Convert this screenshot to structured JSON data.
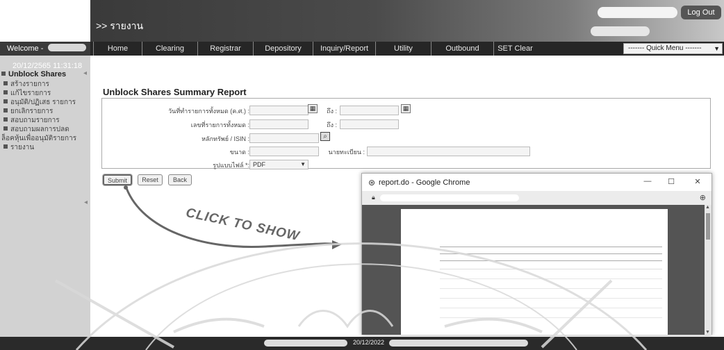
{
  "header": {
    "page_title": ">> รายงาน",
    "logout_label": "Log Out"
  },
  "welcome": {
    "label": "Welcome -"
  },
  "menu": {
    "items": [
      "Home",
      "Clearing",
      "Registrar",
      "Depository",
      "Inquiry/Report",
      "Utility",
      "Outbound",
      "SET Clear"
    ],
    "quick_menu": "------- Quick Menu -------"
  },
  "sidebar": {
    "datetime": "20/12/2565 11:31:18",
    "heading": "Unblock Shares",
    "items": [
      "สร้างรายการ",
      "แก้ไขรายการ",
      "อนุมัติ/ปฏิเสธ รายการ",
      "ยกเลิกรายการ",
      "สอบถามรายการ",
      "สอบถามผลการปลด",
      "ล็อคหุ้นเพื่ออนุมัติรายการ",
      "รายงาน"
    ]
  },
  "form": {
    "title": "Unblock Shares Summary Report",
    "date_label": "วันที่ทำรายการทั้งหมด (ค.ศ.) :",
    "date_to_label": "ถึง :",
    "number_label": "เลขที่รายการทั้งหมด :",
    "number_to_label": "ถึง :",
    "security_label": "หลักทรัพย์ / ISIN :",
    "size_label": "ขนาด :",
    "registrar_label": "นายทะเบียน :",
    "format_label": "รูปแบบไฟล์ *:",
    "format_value": "PDF"
  },
  "buttons": {
    "submit": "Submit",
    "reset": "Reset",
    "back": "Back"
  },
  "annotation": {
    "text": "CLICK TO SHOW"
  },
  "chrome": {
    "title": "report.do - Google Chrome",
    "minimize": "—",
    "maximize": "☐",
    "close": "✕"
  },
  "footer": {
    "date": "20/12/2022"
  },
  "icons": {
    "calendar": "calendar-icon",
    "search": "search-icon",
    "lock": "lock-icon",
    "zoom": "zoom-icon"
  },
  "colors": {
    "banner_dark": "#3a3a3a",
    "menubar": "#262626",
    "sidebar": "#d2d2d2",
    "footer": "#2a2a2a"
  }
}
